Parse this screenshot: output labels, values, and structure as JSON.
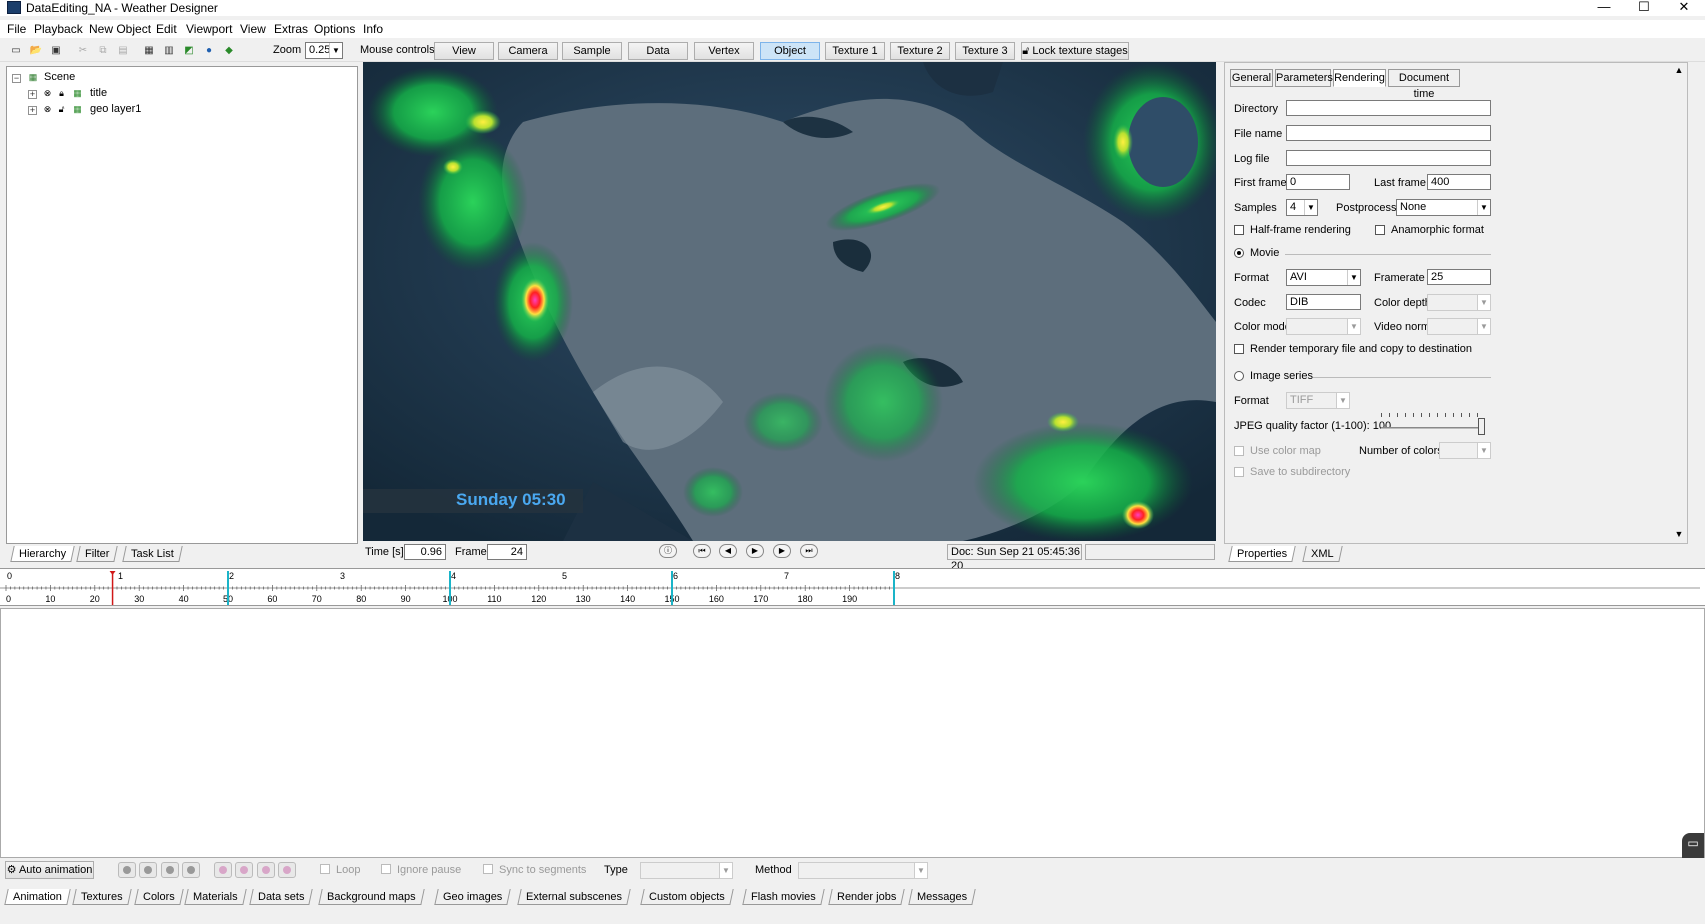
{
  "window": {
    "title": "DataEditing_NA - Weather Designer",
    "minimize": "—",
    "maximize": "☐",
    "close": "✕"
  },
  "menu": [
    "File",
    "Playback",
    "New Object",
    "Edit",
    "Viewport",
    "View",
    "Extras",
    "Options",
    "Info"
  ],
  "toolbar": {
    "zoom_label": "Zoom",
    "zoom_value": "0.25",
    "mouse_controls_label": "Mouse controls",
    "mode_buttons": [
      "View",
      "Camera",
      "Sample",
      "Data",
      "Vertex",
      "Object",
      "Texture 1",
      "Texture 2",
      "Texture 3"
    ],
    "active_mode": "Object",
    "lock_label": "Lock texture stages"
  },
  "hierarchy": {
    "root": "Scene",
    "items": [
      "title",
      "geo layer1"
    ]
  },
  "left_tabs": [
    "Hierarchy",
    "Filter",
    "Task List"
  ],
  "viewport": {
    "overlay_text": "Sunday 05:30"
  },
  "viewport_bar": {
    "time_label": "Time [s]",
    "time_value": "0.96",
    "frame_label": "Frame",
    "frame_value": "24",
    "doc_time": "Doc: Sun Sep 21 05:45:36 20"
  },
  "props": {
    "tabs": [
      "General",
      "Parameters",
      "Rendering",
      "Document time"
    ],
    "active_tab": "Rendering",
    "directory_label": "Directory",
    "filename_label": "File name",
    "logfile_label": "Log file",
    "first_frame_label": "First frame",
    "first_frame": "0",
    "last_frame_label": "Last frame",
    "last_frame": "400",
    "samples_label": "Samples",
    "samples": "4",
    "postprocess_label": "Postprocess",
    "postprocess": "None",
    "halfframe_label": "Half-frame rendering",
    "anamorphic_label": "Anamorphic format",
    "movie_label": "Movie",
    "format_label": "Format",
    "format": "AVI",
    "framerate_label": "Framerate",
    "framerate": "25",
    "codec_label": "Codec",
    "codec": "DIB",
    "colordepth_label": "Color depth",
    "colormode_label": "Color mode",
    "videonorm_label": "Video norm",
    "render_temp_label": "Render temporary file and copy to destination",
    "image_series_label": "Image series",
    "img_format_label": "Format",
    "img_format": "TIFF",
    "jpeg_label": "JPEG quality factor (1-100): 100",
    "jpeg_quality": 100,
    "use_colormap_label": "Use color map",
    "num_colors_label": "Number of colors",
    "save_subdir_label": "Save to subdirectory"
  },
  "prop_bottom_tabs": [
    "Properties",
    "XML"
  ],
  "timeline": {
    "seconds": [
      "0",
      "1",
      "2",
      "3",
      "4",
      "5",
      "6",
      "7",
      "8"
    ],
    "frames": [
      "0",
      "10",
      "20",
      "30",
      "40",
      "50",
      "60",
      "70",
      "80",
      "90",
      "100",
      "110",
      "120",
      "130",
      "140",
      "150",
      "160",
      "170",
      "180",
      "190"
    ],
    "current_frame": 24,
    "keyframes": [
      50,
      100,
      150,
      200
    ]
  },
  "anim_controls": {
    "auto_animation": "Auto animation",
    "loop": "Loop",
    "ignore_pause": "Ignore pause",
    "sync_segments": "Sync to segments",
    "type_label": "Type",
    "method_label": "Method"
  },
  "bottom_tabs": [
    "Animation",
    "Textures",
    "Colors",
    "Materials",
    "Data sets",
    "Background maps",
    "Geo images",
    "External subscenes",
    "Custom objects",
    "Flash movies",
    "Render jobs",
    "Messages"
  ],
  "colors": {
    "accent": "#7eb4ea",
    "timeline_marker": "#1ab4c8",
    "current_marker": "#d01818",
    "overlay_text": "#4aa8f0"
  }
}
